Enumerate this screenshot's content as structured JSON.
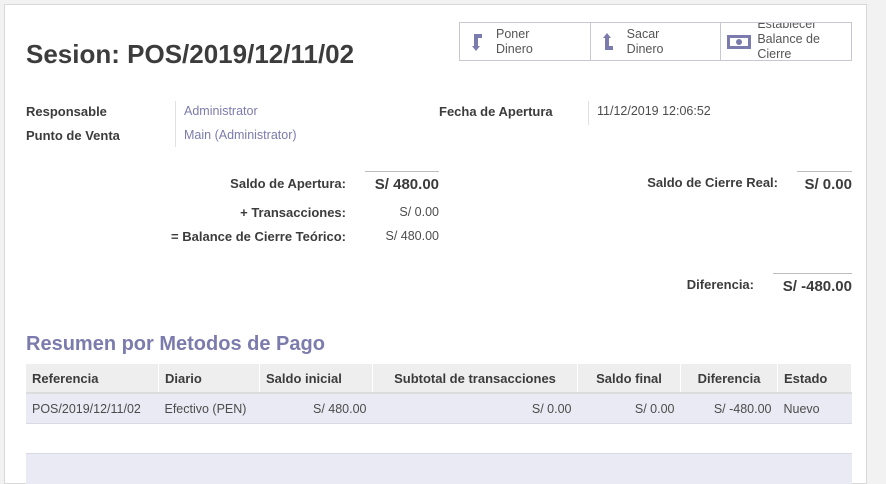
{
  "title": "Sesion: POS/2019/12/11/02",
  "stat_buttons": [
    {
      "lines": [
        "Poner",
        "Dinero"
      ],
      "icon": "arrow-down-icon"
    },
    {
      "lines": [
        "Sacar",
        "Dinero"
      ],
      "icon": "arrow-up-icon"
    },
    {
      "lines": [
        "Establecer",
        "Balance de",
        "Cierre"
      ],
      "icon": "money-bill-icon"
    }
  ],
  "fields": {
    "responsable_label": "Responsable",
    "responsable_value": "Administrator",
    "punto_label": "Punto de Venta",
    "punto_value": "Main (Administrator)",
    "fecha_label": "Fecha de Apertura",
    "fecha_value": "11/12/2019 12:06:52"
  },
  "balances": {
    "saldo_apertura_label": "Saldo de Apertura:",
    "saldo_apertura_value": "S/ 480.00",
    "transacciones_label": "+ Transacciones:",
    "transacciones_value": "S/ 0.00",
    "teorico_label": "= Balance de Cierre Teórico:",
    "teorico_value": "S/ 480.00",
    "cierre_real_label": "Saldo de Cierre Real:",
    "cierre_real_value": "S/ 0.00",
    "diferencia_label": "Diferencia:",
    "diferencia_value": "S/ -480.00"
  },
  "payment_summary": {
    "title": "Resumen por Metodos de Pago",
    "columns": [
      "Referencia",
      "Diario",
      "Saldo inicial",
      "Subtotal de transacciones",
      "Saldo final",
      "Diferencia",
      "Estado"
    ],
    "rows": [
      [
        "POS/2019/12/11/02",
        "Efectivo (PEN)",
        "S/ 480.00",
        "S/ 0.00",
        "S/ 0.00",
        "S/ -480.00",
        "Nuevo"
      ]
    ]
  },
  "colors": {
    "accent": "#7c7bad",
    "row_bg": "#eaeaf4",
    "header_bg": "#eeeeee"
  }
}
